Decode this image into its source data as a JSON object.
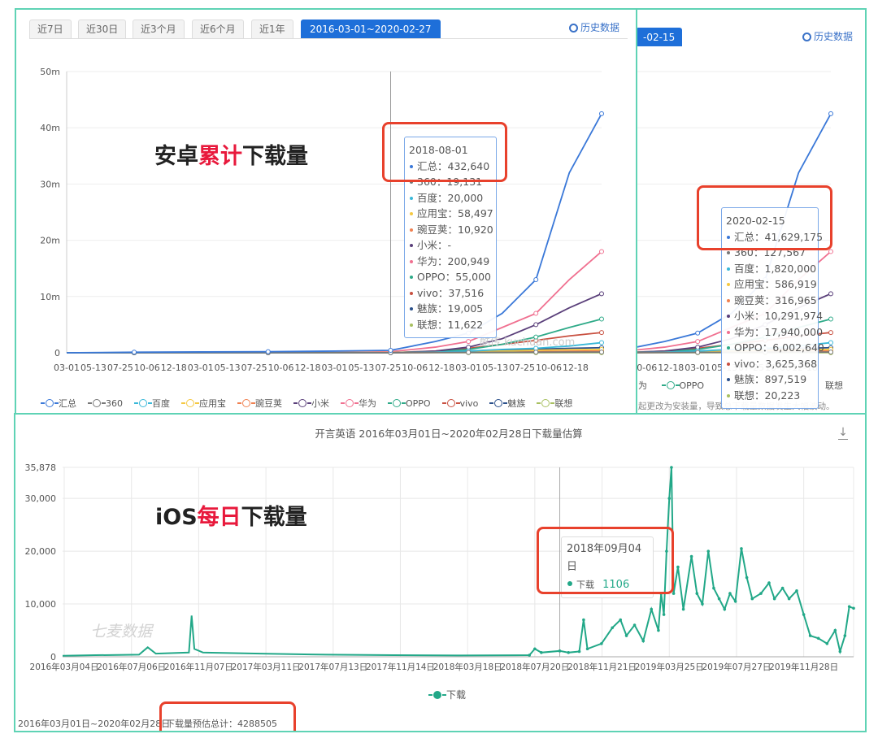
{
  "android": {
    "tabs": [
      "近7日",
      "近30日",
      "近3个月",
      "近6个月",
      "近1年",
      "2016-03-01~2020-02-27"
    ],
    "history_label": "历史数据",
    "overlay": {
      "pre": "安卓",
      "highlight": "累计",
      "post": "下载量"
    },
    "watermark": "酷传 kuchuan.com",
    "tooltip": {
      "date": "2018-08-01",
      "rows": [
        [
          "汇总",
          "432,640"
        ],
        [
          "360",
          "19,131"
        ],
        [
          "百度",
          "20,000"
        ],
        [
          "应用宝",
          "58,497"
        ],
        [
          "豌豆荚",
          "10,920"
        ],
        [
          "小米",
          "-"
        ],
        [
          "华为",
          "200,949"
        ],
        [
          "OPPO",
          "55,000"
        ],
        [
          "vivo",
          "37,516"
        ],
        [
          "魅族",
          "19,005"
        ],
        [
          "联想",
          "11,622"
        ]
      ]
    }
  },
  "android_back": {
    "tab_partial": "-02-15",
    "history_label": "历史数据",
    "legend_partial": [
      "为",
      "OPPO",
      "联想"
    ],
    "note": "起更改为安装量，导致总下载量数据发生大幅波动。",
    "tooltip": {
      "date": "2020-02-15",
      "rows": [
        [
          "汇总",
          "41,629,175"
        ],
        [
          "360",
          "127,567"
        ],
        [
          "百度",
          "1,820,000"
        ],
        [
          "应用宝",
          "586,919"
        ],
        [
          "豌豆荚",
          "316,965"
        ],
        [
          "小米",
          "10,291,974"
        ],
        [
          "华为",
          "17,940,000"
        ],
        [
          "OPPO",
          "6,002,640"
        ],
        [
          "vivo",
          "3,625,368"
        ],
        [
          "魅族",
          "897,519"
        ],
        [
          "联想",
          "20,223"
        ]
      ]
    }
  },
  "ios": {
    "overlay": {
      "pre": "iOS",
      "highlight": "每日",
      "post": "下载量"
    },
    "watermark": "七麦数据",
    "tooltip": {
      "date": "2018年09月04日",
      "label": "下载",
      "value": "1106"
    },
    "footer_range": "2016年03月01日~2020年02月28日",
    "footer_total": "下载量预估总计：4288505",
    "download_icon": "download-icon"
  },
  "chart_data": [
    {
      "type": "line",
      "title": "安卓累计下载量",
      "ylabel": "",
      "xlabel": "",
      "ylim": [
        0,
        50
      ],
      "y_unit": "m",
      "yticks": [
        "0",
        "10m",
        "20m",
        "30m",
        "40m",
        "50m"
      ],
      "xticks": [
        [
          "2016-03-01",
          "03-01"
        ],
        [
          "2016-05-13",
          "05-13"
        ],
        [
          "2016-07-25",
          "07-25"
        ],
        [
          "2016-10-06",
          "10-06"
        ],
        [
          "2016-12-18",
          "12-18"
        ],
        [
          "2017-03-01",
          "03-01"
        ],
        [
          "2017-05-13",
          "05-13"
        ],
        [
          "2017-07-25",
          "07-25"
        ],
        [
          "2017-10-06",
          "10-06"
        ],
        [
          "2017-12-18",
          "12-18"
        ],
        [
          "2018-03-01",
          "03-01"
        ],
        [
          "2018-05-13",
          "05-13"
        ],
        [
          "2018-07-25",
          "07-25"
        ],
        [
          "2018-10-06",
          "10-06"
        ],
        [
          "2018-12-18",
          "12-18"
        ],
        [
          "2019-03-01",
          "03-01"
        ],
        [
          "2019-05-13",
          "05-13"
        ],
        [
          "2019-07-25",
          "07-25"
        ],
        [
          "2019-10-06",
          "10-06"
        ],
        [
          "2019-12-18",
          "12-18"
        ]
      ],
      "xrange": [
        "2016-03-01",
        "2020-02-27"
      ],
      "x": [
        "2016-03-01",
        "2016-09-01",
        "2017-03-01",
        "2017-09-01",
        "2018-03-01",
        "2018-08-01",
        "2018-12-01",
        "2019-03-01",
        "2019-06-01",
        "2019-09-01",
        "2019-12-01",
        "2020-02-27"
      ],
      "cursor": "2018-08-01",
      "legend_position": "bottom",
      "series": [
        {
          "name": "汇总",
          "color": "#3a78d8",
          "values": [
            0,
            0.1,
            0.15,
            0.2,
            0.3,
            0.43,
            2.0,
            3.5,
            7,
            13,
            32,
            42.5
          ]
        },
        {
          "name": "360",
          "color": "#777777",
          "values": [
            0,
            0,
            0.01,
            0.01,
            0.015,
            0.019,
            0.04,
            0.06,
            0.08,
            0.1,
            0.12,
            0.13
          ]
        },
        {
          "name": "百度",
          "color": "#3ab8d8",
          "values": [
            0,
            0,
            0,
            0.01,
            0.015,
            0.02,
            0.1,
            0.3,
            0.6,
            0.8,
            1.2,
            1.8
          ]
        },
        {
          "name": "应用宝",
          "color": "#f5c842",
          "values": [
            0,
            0.01,
            0.02,
            0.03,
            0.045,
            0.058,
            0.1,
            0.2,
            0.3,
            0.45,
            0.55,
            0.59
          ]
        },
        {
          "name": "豌豆荚",
          "color": "#f08050",
          "values": [
            0,
            0,
            0.005,
            0.007,
            0.009,
            0.011,
            0.05,
            0.1,
            0.15,
            0.22,
            0.28,
            0.32
          ]
        },
        {
          "name": "小米",
          "color": "#5a3f7a",
          "values": [
            0,
            0,
            0,
            0,
            0,
            0,
            0.3,
            1,
            2.5,
            5,
            8,
            10.5
          ]
        },
        {
          "name": "华为",
          "color": "#f07090",
          "values": [
            0,
            0,
            0,
            0,
            0.05,
            0.2,
            1,
            2,
            4.5,
            7,
            13,
            18
          ]
        },
        {
          "name": "OPPO",
          "color": "#2eaa88",
          "values": [
            0,
            0,
            0,
            0,
            0.02,
            0.055,
            0.2,
            0.6,
            1.5,
            2.8,
            4.5,
            6
          ]
        },
        {
          "name": "vivo",
          "color": "#c85040",
          "values": [
            0,
            0,
            0,
            0,
            0.02,
            0.038,
            0.3,
            0.8,
            1.5,
            2.2,
            3,
            3.6
          ]
        },
        {
          "name": "魅族",
          "color": "#2a4f8a",
          "values": [
            0,
            0,
            0.005,
            0.01,
            0.015,
            0.019,
            0.1,
            0.3,
            0.5,
            0.65,
            0.8,
            0.9
          ]
        },
        {
          "name": "联想",
          "color": "#a8c060",
          "values": [
            0,
            0,
            0.003,
            0.006,
            0.009,
            0.012,
            0.014,
            0.015,
            0.017,
            0.018,
            0.02,
            0.02
          ]
        }
      ]
    },
    {
      "type": "line",
      "title": "开言英语 2016年03月01日~2020年02月28日下载量估算",
      "ylim": [
        0,
        35878
      ],
      "yticks": [
        "0",
        "10,000",
        "20,000",
        "30,000",
        "35,878"
      ],
      "ytick_values": [
        0,
        10000,
        20000,
        30000,
        35878
      ],
      "xrange": [
        "2016-03-01",
        "2020-02-28"
      ],
      "xticks": [
        "2016年03月04日",
        "2016年07月06日",
        "2016年11月07日",
        "2017年03月11日",
        "2017年07月13日",
        "2017年11月14日",
        "2018年03月18日",
        "2018年07月20日",
        "2018年11月21日",
        "2019年03月25日",
        "2019年07月27日",
        "2019年11月28日"
      ],
      "xtick_dates": [
        "2016-03-04",
        "2016-07-06",
        "2016-11-07",
        "2017-03-11",
        "2017-07-13",
        "2017-11-14",
        "2018-03-18",
        "2018-07-20",
        "2018-11-21",
        "2019-03-25",
        "2019-07-27",
        "2019-11-28"
      ],
      "cursor": "2018-09-04",
      "legend_position": "bottom",
      "series": [
        {
          "name": "下载",
          "color": "#22a888",
          "points": [
            [
              "2016-03-01",
              200
            ],
            [
              "2016-05-01",
              300
            ],
            [
              "2016-07-20",
              400
            ],
            [
              "2016-08-05",
              1800
            ],
            [
              "2016-08-20",
              600
            ],
            [
              "2016-10-20",
              800
            ],
            [
              "2016-10-25",
              7800
            ],
            [
              "2016-10-30",
              1500
            ],
            [
              "2016-11-15",
              800
            ],
            [
              "2017-03-01",
              600
            ],
            [
              "2017-07-01",
              400
            ],
            [
              "2017-11-01",
              300
            ],
            [
              "2018-03-01",
              250
            ],
            [
              "2018-07-10",
              300
            ],
            [
              "2018-07-20",
              1500
            ],
            [
              "2018-08-01",
              800
            ],
            [
              "2018-09-04",
              1106
            ],
            [
              "2018-09-20",
              800
            ],
            [
              "2018-10-10",
              1000
            ],
            [
              "2018-10-18",
              7000
            ],
            [
              "2018-10-25",
              1500
            ],
            [
              "2018-11-20",
              2500
            ],
            [
              "2018-12-10",
              5500
            ],
            [
              "2018-12-25",
              7000
            ],
            [
              "2019-01-05",
              4000
            ],
            [
              "2019-01-20",
              6000
            ],
            [
              "2019-02-05",
              3000
            ],
            [
              "2019-02-20",
              9000
            ],
            [
              "2019-03-05",
              5000
            ],
            [
              "2019-03-10",
              12000
            ],
            [
              "2019-03-15",
              8000
            ],
            [
              "2019-03-20",
              20000
            ],
            [
              "2019-03-25",
              30000
            ],
            [
              "2019-03-29",
              35878
            ],
            [
              "2019-04-02",
              12000
            ],
            [
              "2019-04-10",
              17000
            ],
            [
              "2019-04-20",
              9000
            ],
            [
              "2019-05-05",
              19000
            ],
            [
              "2019-05-15",
              12000
            ],
            [
              "2019-05-25",
              10000
            ],
            [
              "2019-06-05",
              20000
            ],
            [
              "2019-06-15",
              13000
            ],
            [
              "2019-06-25",
              11000
            ],
            [
              "2019-07-05",
              9000
            ],
            [
              "2019-07-15",
              12000
            ],
            [
              "2019-07-25",
              10500
            ],
            [
              "2019-08-05",
              20500
            ],
            [
              "2019-08-15",
              15000
            ],
            [
              "2019-08-25",
              11000
            ],
            [
              "2019-09-10",
              12000
            ],
            [
              "2019-09-25",
              14000
            ],
            [
              "2019-10-05",
              11000
            ],
            [
              "2019-10-20",
              13000
            ],
            [
              "2019-11-01",
              11000
            ],
            [
              "2019-11-15",
              12500
            ],
            [
              "2019-11-28",
              8000
            ],
            [
              "2019-12-10",
              4000
            ],
            [
              "2019-12-25",
              3500
            ],
            [
              "2020-01-10",
              2500
            ],
            [
              "2020-01-25",
              5000
            ],
            [
              "2020-02-03",
              1000
            ],
            [
              "2020-02-12",
              4000
            ],
            [
              "2020-02-20",
              9500
            ],
            [
              "2020-02-28",
              9200
            ]
          ]
        }
      ]
    }
  ]
}
